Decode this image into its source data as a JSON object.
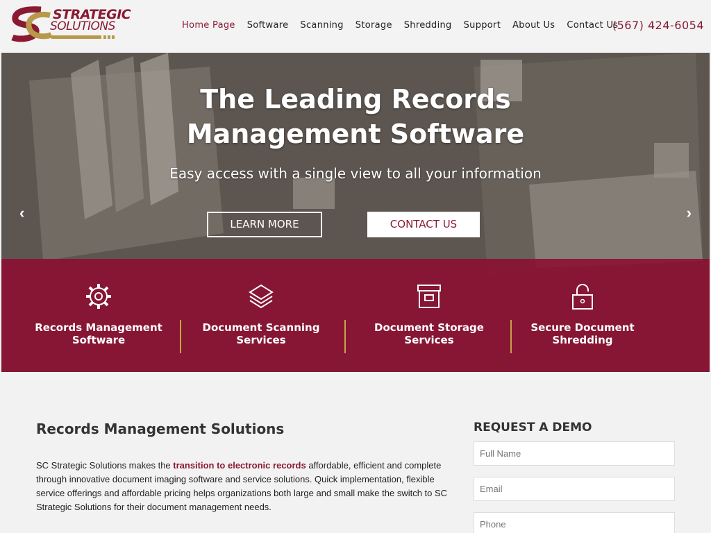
{
  "logo": {
    "line1": "STRATEGIC",
    "line2": "SOLUTIONS"
  },
  "nav": {
    "items": [
      "Home Page",
      "Software",
      "Scanning",
      "Storage",
      "Shredding",
      "Support",
      "About Us",
      "Contact Us"
    ],
    "phone": "(567) 424-6054"
  },
  "hero": {
    "title_line1": "The Leading Records",
    "title_line2": "Management Software",
    "subtitle": "Easy access with a single view to all your information",
    "learn_more": "LEARN MORE",
    "contact_us": "CONTACT US"
  },
  "services": [
    {
      "line1": "Records Management",
      "line2": "Software",
      "icon": "gear-icon"
    },
    {
      "line1": "Document Scanning",
      "line2": "Services",
      "icon": "layers-icon"
    },
    {
      "line1": "Document Storage",
      "line2": "Services",
      "icon": "archive-box-icon"
    },
    {
      "line1": "Secure Document",
      "line2": "Shredding",
      "icon": "padlock-icon"
    }
  ],
  "content": {
    "heading": "Records Management Solutions",
    "para_before": "SC Strategic Solutions makes the ",
    "para_link": "transition to electronic records",
    "para_after": " affordable, efficient and complete through innovative document imaging software and service solutions. Quick implementation, flexible service offerings and affordable pricing helps organizations both large and small make the switch to SC Strategic Solutions for their document management needs."
  },
  "demo": {
    "heading": "REQUEST A DEMO",
    "full_name_placeholder": "Full Name",
    "email_placeholder": "Email",
    "phone_placeholder": "Phone"
  },
  "colors": {
    "brand": "#8a1a32",
    "accent_gold": "#c9a24a"
  }
}
